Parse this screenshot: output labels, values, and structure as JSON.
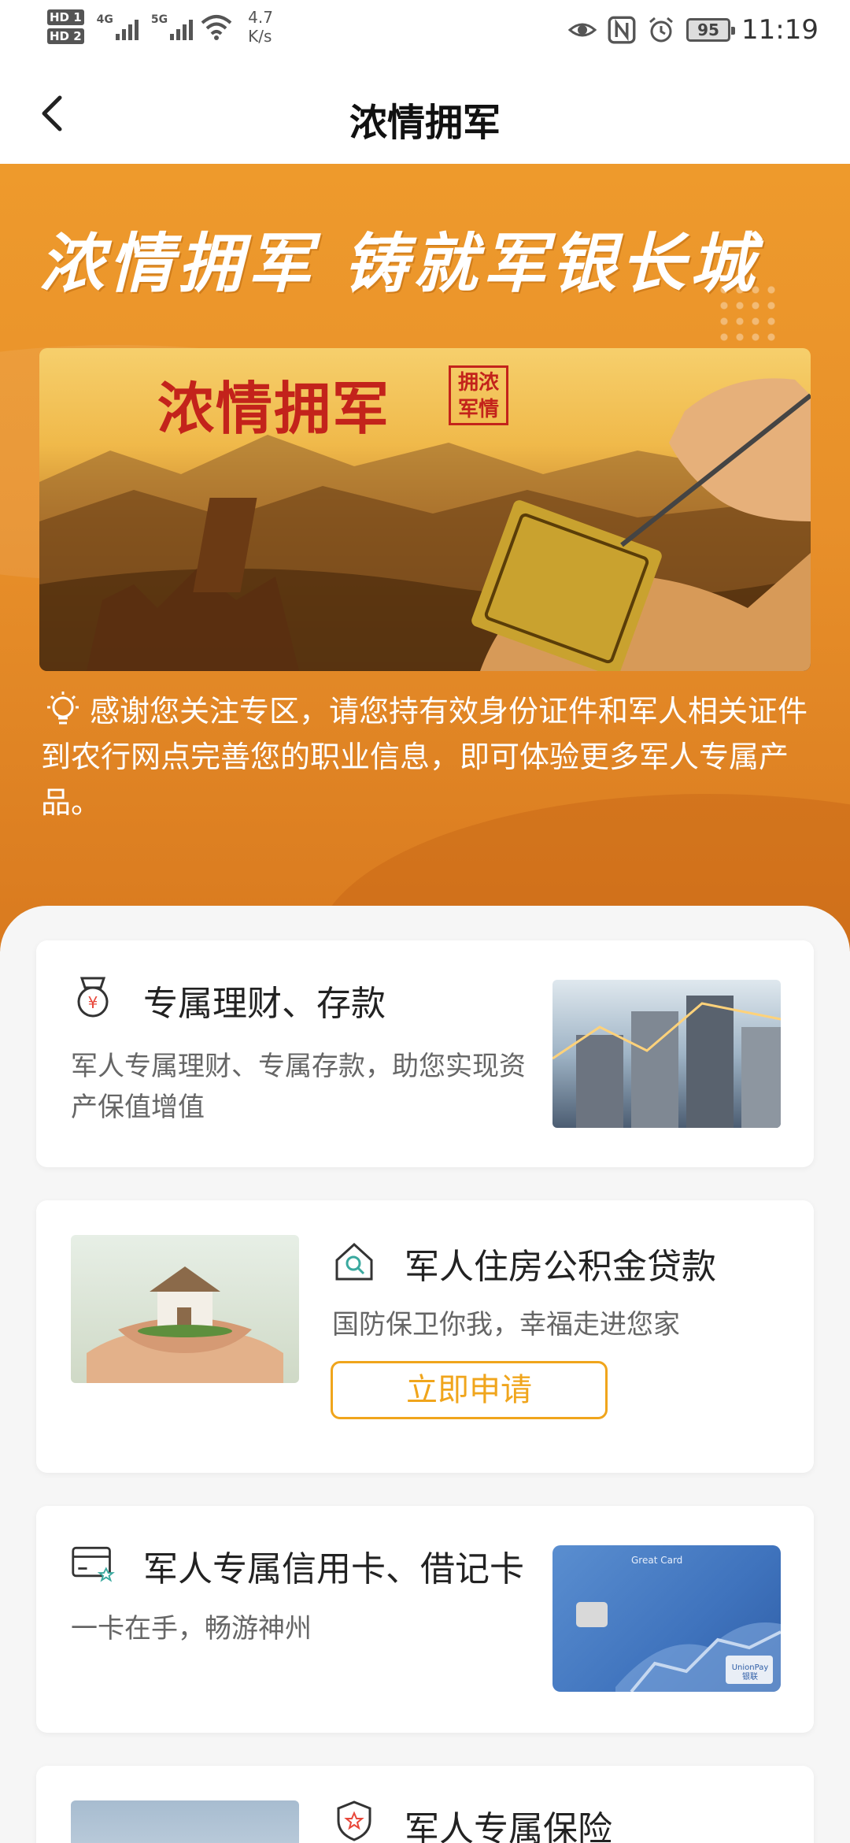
{
  "status_bar": {
    "hd1": "HD 1",
    "hd2": "HD 2",
    "net1": "4G",
    "net2": "5G",
    "speed_value": "4.7",
    "speed_unit": "K/s",
    "battery": "95",
    "time": "11:19",
    "icons": [
      "eye-icon",
      "nfc-icon",
      "alarm-icon",
      "battery-icon"
    ]
  },
  "header": {
    "title": "浓情拥军"
  },
  "hero": {
    "slogan": "浓情拥军  铸就军银长城",
    "banner_title": "浓情拥军",
    "seal_text": "拥浓军情",
    "notice": "感谢您关注专区，请您持有效身份证件和军人相关证件到农行网点完善您的职业信息，即可体验更多军人专属产品。"
  },
  "cards": {
    "wealth": {
      "title": "专属理财、存款",
      "desc": "军人专属理财、专属存款，助您实现资产保值增值"
    },
    "loan": {
      "title": "军人住房公积金贷款",
      "desc": "国防保卫你我，幸福走进您家",
      "button": "立即申请"
    },
    "card": {
      "title": "军人专属信用卡、借记卡",
      "desc": "一卡在手，畅游神州",
      "card_label": "Great Card",
      "card_brand": "UnionPay 银联"
    },
    "insurance": {
      "title": "军人专属保险"
    }
  },
  "colors": {
    "accent": "#f0a51c",
    "hero": "#e8902a",
    "seal_red": "#c3231b"
  }
}
